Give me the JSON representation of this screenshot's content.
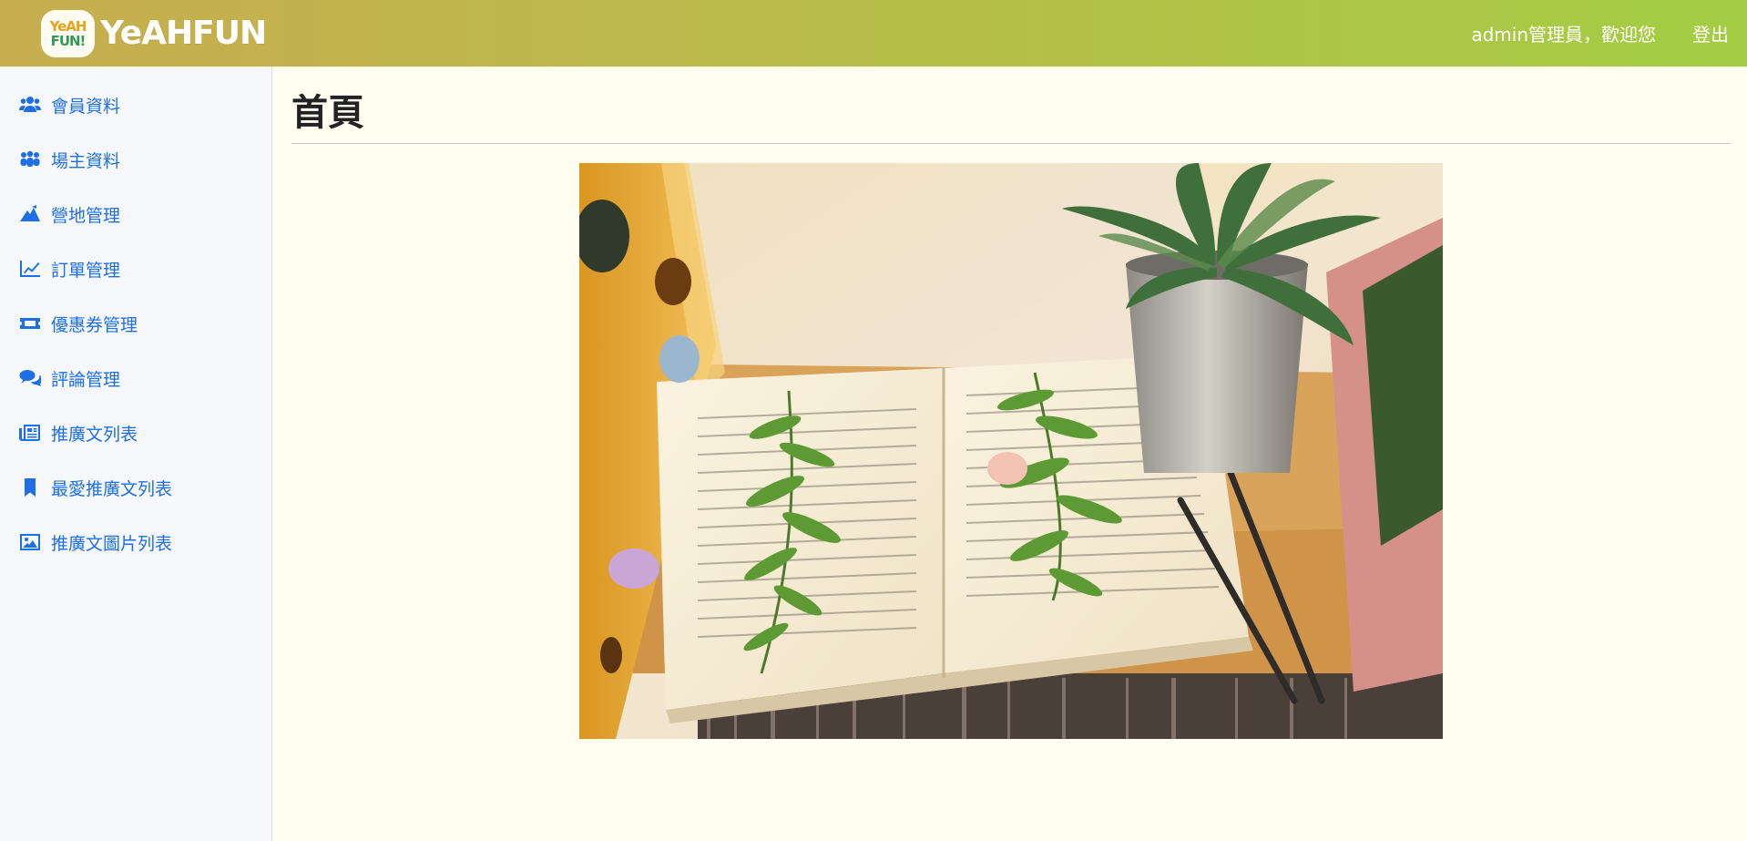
{
  "header": {
    "logo_badge_line1": "YeAH",
    "logo_badge_line2": "FUN!",
    "logo_text": "YeAHFUN",
    "welcome": "admin管理員，歡迎您",
    "logout": "登出"
  },
  "sidebar": {
    "items": [
      {
        "label": "會員資料",
        "icon": "users-icon"
      },
      {
        "label": "場主資料",
        "icon": "people-group-icon"
      },
      {
        "label": "營地管理",
        "icon": "campground-icon"
      },
      {
        "label": "訂單管理",
        "icon": "chart-line-icon"
      },
      {
        "label": "優惠券管理",
        "icon": "ticket-icon"
      },
      {
        "label": "評論管理",
        "icon": "comments-icon"
      },
      {
        "label": "推廣文列表",
        "icon": "newspaper-icon"
      },
      {
        "label": "最愛推廣文列表",
        "icon": "bookmark-icon"
      },
      {
        "label": "推廣文圖片列表",
        "icon": "image-icon"
      }
    ]
  },
  "main": {
    "title": "首頁"
  },
  "colors": {
    "accent": "#1e6fe6",
    "header_start": "#c8ad4f",
    "header_end": "#a4cd43",
    "background": "#fffef0"
  }
}
